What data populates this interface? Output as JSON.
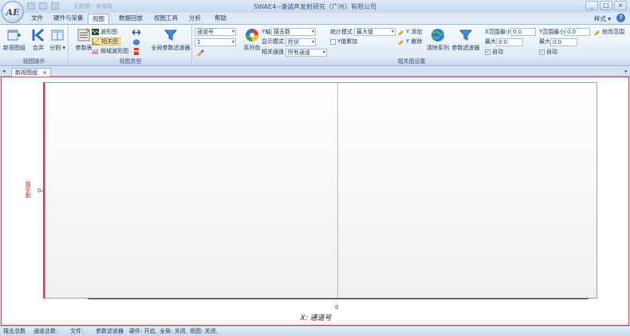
{
  "window": {
    "title": "SWAE4--清诚声发射研究（广州）有限公司",
    "logo_text": "AE",
    "qat_text": "无标题 - 未保存",
    "controls": [
      "_",
      "□",
      "×"
    ]
  },
  "tabs": [
    {
      "label": "文件",
      "active": false
    },
    {
      "label": "硬件与采集",
      "active": false
    },
    {
      "label": "视图",
      "active": true
    },
    {
      "label": "数据回放",
      "active": false
    },
    {
      "label": "视图工具",
      "active": false
    },
    {
      "label": "分析",
      "active": false
    },
    {
      "label": "帮助",
      "active": false
    }
  ],
  "style_menu": "样式 ▾",
  "help_icon": "?",
  "ribbon": {
    "view_ops": {
      "label": "视图操作",
      "new_group": "新视图组",
      "merge": "合并",
      "split": "分割 ▾"
    },
    "view_types": {
      "label": "视图类型",
      "param_table": "参数表",
      "waveform": "波形图",
      "correlation": "相关图",
      "freq_wave": "频域波形图",
      "global_filter": "全局参数滤波器"
    },
    "corr_settings": {
      "label": "相关图设置",
      "channel_label": "通道号",
      "channel_value": "1",
      "series_color": "系列色",
      "yaxis_label": "Y轴",
      "yaxis_value": "撞击数",
      "display_mode_label": "显示模式",
      "display_mode_value": "柱状",
      "related_channel_label": "相关通道",
      "related_channel_value": "所有通道",
      "stat_mode_label": "统计模式",
      "stat_mode_value": "最大值",
      "y_accumulate": "Y值累加",
      "y_add": "Y 添加",
      "y_delete": "Y 删除",
      "clear_series": "清除系列",
      "param_filter": "参数滤波器",
      "x_min_label": "X范围最小",
      "x_min_value": "0.0",
      "x_max_label": "最大",
      "x_max_value": "0.0",
      "x_auto": "自动",
      "y_min_label": "Y范围最小",
      "y_min_value": "0.0",
      "y_max_label": "最大",
      "y_max_value": "0.0",
      "y_auto": "自动",
      "modify_range": "修改范围"
    }
  },
  "doc_tab": {
    "label": "新视图组",
    "close": "×"
  },
  "chart_data": {
    "type": "bar",
    "xlabel": "X: 通道号",
    "ylabel": "撞击数",
    "x_ticks": [
      "0"
    ],
    "y_ticks": [
      "0"
    ],
    "series": [],
    "grid": false
  },
  "status": {
    "hit_total": "撞击总数",
    "channel_total": "通道总数：",
    "file": "文件：",
    "param_filter": "参数滤波器",
    "hardware": "硬件: 开启,",
    "global": "全局: 关闭,",
    "view": "视图: 关闭,"
  }
}
